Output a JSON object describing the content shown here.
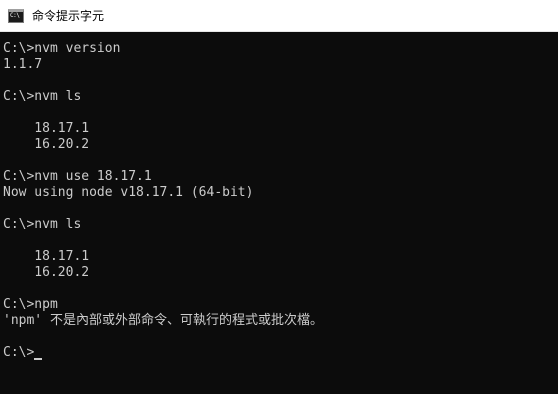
{
  "window": {
    "title": "命令提示字元",
    "icon": "console-app-icon",
    "icon_glyph": "C:\\"
  },
  "console": {
    "lines": [
      "C:\\>nvm version",
      "1.1.7",
      "",
      "C:\\>nvm ls",
      "",
      "    18.17.1",
      "    16.20.2",
      "",
      "C:\\>nvm use 18.17.1",
      "Now using node v18.17.1 (64-bit)",
      "",
      "C:\\>nvm ls",
      "",
      "    18.17.1",
      "    16.20.2",
      "",
      "C:\\>npm",
      "'npm' 不是內部或外部命令、可執行的程式或批次檔。",
      ""
    ],
    "current_prompt": "C:\\>",
    "colors": {
      "background": "#0c0c0c",
      "foreground": "#cccccc"
    }
  }
}
